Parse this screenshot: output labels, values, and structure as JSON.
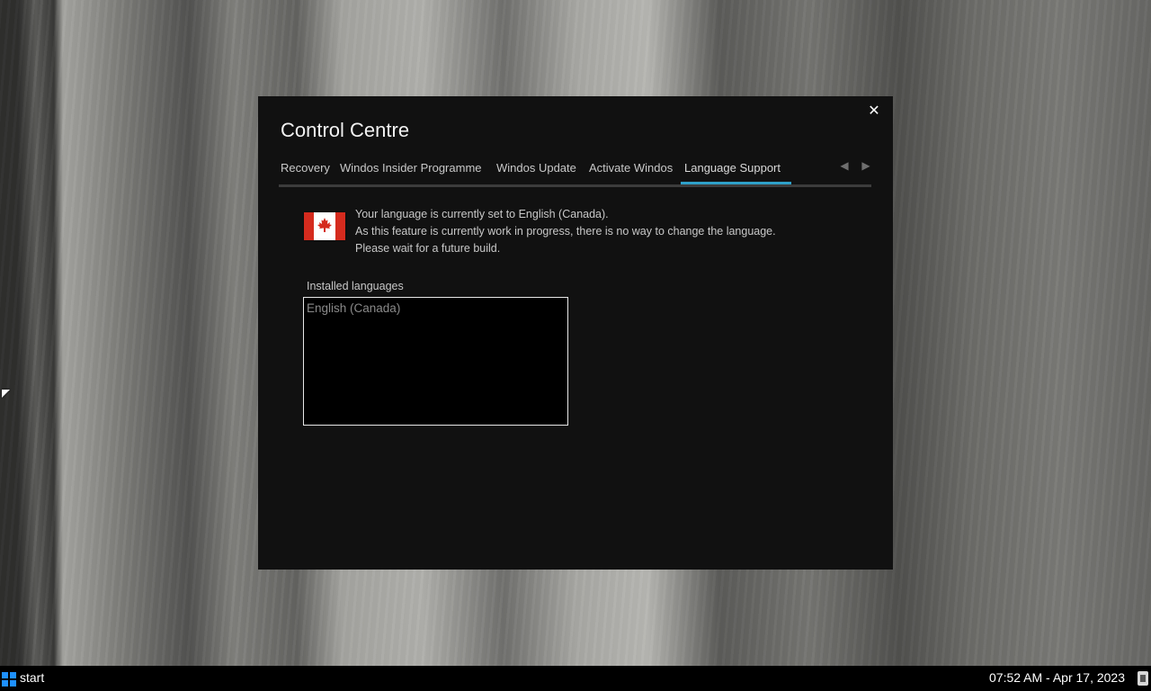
{
  "window": {
    "title": "Control Centre",
    "close_glyph": "✕"
  },
  "tabs": [
    {
      "label": "Recovery"
    },
    {
      "label": "Windos Insider Programme"
    },
    {
      "label": "Windos Update"
    },
    {
      "label": "Activate Windos"
    },
    {
      "label": "Language Support",
      "active": true
    }
  ],
  "tab_nav": {
    "prev_icon": "arrow-left-icon",
    "next_icon": "arrow-right-icon",
    "prev_glyph": "◀",
    "next_glyph": "▶"
  },
  "language": {
    "flag_icon": "canada-flag-icon",
    "lines": [
      "Your language is currently set to English (Canada).",
      "As this feature is currently work in progress, there is no way to change the language.",
      "Please wait for a future build."
    ],
    "installed_label": "Installed languages",
    "installed": [
      "English (Canada)"
    ]
  },
  "taskbar": {
    "start_label": "start",
    "clock": "07:52 AM - Apr 17, 2023"
  },
  "colors": {
    "accent": "#2ea0c8",
    "window_bg": "#111111",
    "start_logo": "#1e90ff"
  }
}
